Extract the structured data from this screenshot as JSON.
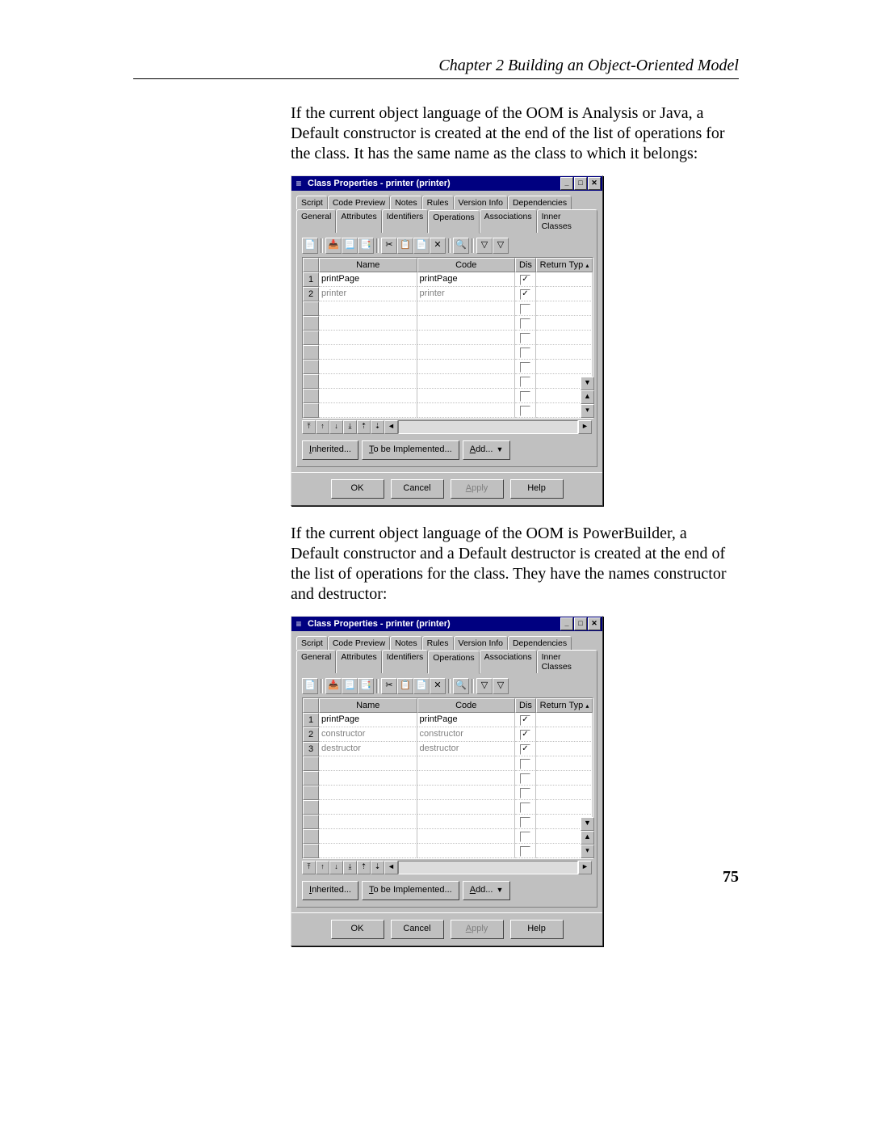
{
  "header": "Chapter 2   Building an Object-Oriented Model",
  "para1": "If the current object language of the OOM is Analysis or Java, a Default constructor is created at the end of the list of operations for the class. It has the same name as the class to which it belongs:",
  "para2": "If the current object language of the OOM is PowerBuilder, a Default constructor and a Default destructor is created at the end of the list of operations for the class. They have the names constructor and destructor:",
  "page_number": "75",
  "dialog": {
    "title": "Class Properties - printer (printer)",
    "tabs_row1": [
      "Script",
      "Code Preview",
      "Notes",
      "Rules",
      "Version Info",
      "Dependencies"
    ],
    "tabs_row2": [
      "General",
      "Attributes",
      "Identifiers",
      "Operations",
      "Associations",
      "Inner Classes"
    ],
    "active_tab": "Operations",
    "columns": {
      "name": "Name",
      "code": "Code",
      "dis": "Dis",
      "ret": "Return Typ"
    },
    "buttons": {
      "inherited": "Inherited...",
      "inherited_ul": "I",
      "toimpl": "To be Implemented...",
      "toimpl_ul": "T",
      "add": "Add...",
      "add_ul": "A",
      "ok": "OK",
      "cancel": "Cancel",
      "apply": "Apply",
      "apply_ul": "A",
      "help": "Help"
    }
  },
  "grid1": [
    {
      "n": "1",
      "name": "printPage",
      "code": "printPage",
      "checked": true,
      "dim": false
    },
    {
      "n": "2",
      "name": "printer",
      "code": "printer",
      "checked": true,
      "dim": true
    }
  ],
  "grid2": [
    {
      "n": "1",
      "name": "printPage",
      "code": "printPage",
      "checked": true,
      "dim": false
    },
    {
      "n": "2",
      "name": "constructor",
      "code": "constructor",
      "checked": true,
      "dim": true
    },
    {
      "n": "3",
      "name": "destructor",
      "code": "destructor",
      "checked": true,
      "dim": true
    }
  ],
  "toolbar_icons": [
    "📄",
    "📥",
    "📃",
    "📑",
    "✂",
    "📋",
    "📄",
    "✕",
    "🔍",
    "▽",
    "▽"
  ]
}
